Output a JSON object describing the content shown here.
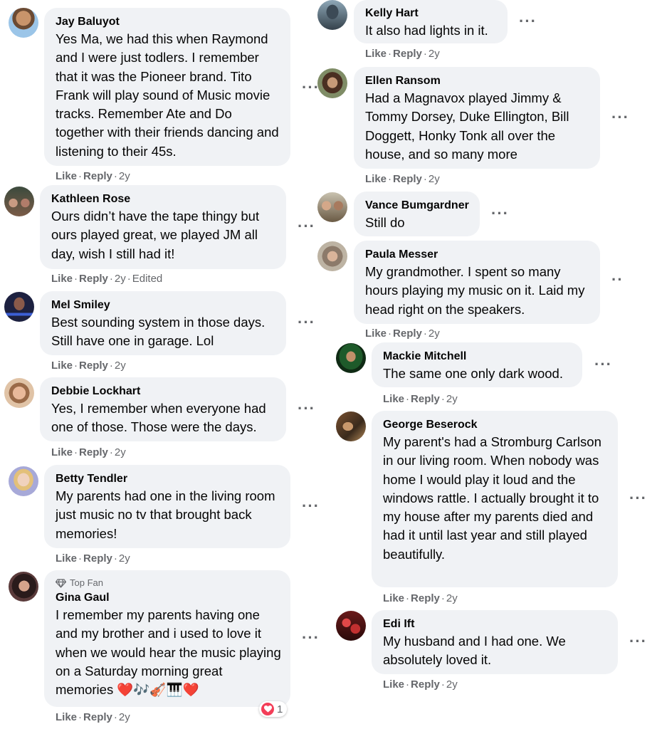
{
  "meta": {
    "like": "Like",
    "reply": "Reply",
    "dot": "·"
  },
  "comments": [
    {
      "name": "Jay Baluyot",
      "text": "Yes Ma, we had this when Raymond and I were just todlers. I remember that it was the Pioneer brand. Tito Frank will play sound of Music movie tracks. Remember Ate and Do together with their friends dancing and listening to their 45s.",
      "time": "2y"
    },
    {
      "name": "Kathleen Rose",
      "text": "Ours didn’t have the tape thingy but ours played great, we played JM all day, wish I still had it!",
      "time": "2y",
      "edited": "Edited"
    },
    {
      "name": "Mel Smiley",
      "text": "Best sounding system in those days. Still have one in garage. Lol",
      "time": "2y"
    },
    {
      "name": "Debbie Lockhart",
      "text": "Yes, I remember when everyone had one of those. Those were the days.",
      "time": "2y"
    },
    {
      "name": "Betty Tendler",
      "text": "My parents had one in the living room just music no tv that brought back memories!",
      "time": "2y"
    },
    {
      "badge": "Top Fan",
      "name": "Gina Gaul",
      "text": "I remember my parents having one and my brother and i used to love it when we would hear the music playing on a Saturday morning great memories ❤️🎶🎻🎹❤️",
      "time": "2y",
      "reaction_count": "1"
    },
    {
      "name": "Kelly Hart",
      "text": "It also had lights in it.",
      "time": "2y"
    },
    {
      "name": "Ellen Ransom",
      "text": "Had a Magnavox played Jimmy & Tommy Dorsey, Duke Ellington, Bill Doggett, Honky Tonk all over the house, and so many more",
      "time": "2y"
    },
    {
      "name": "Vance Bumgardner",
      "text": "Still do",
      "time": ""
    },
    {
      "name": "Paula Messer",
      "text": "My grandmother. I spent so many hours playing my music on it. Laid my head right on the speakers.",
      "time": "2y"
    },
    {
      "name": "Mackie Mitchell",
      "text": "The same one only dark wood.",
      "time": "2y"
    },
    {
      "name": "George Beserock",
      "text": "My parent's had a Stromburg Carlson in our living room. When nobody was home I would play it loud and the windows rattle. I actually brought it to my house after my parents died and had it until last year and still played beautifully.",
      "time": "2y"
    },
    {
      "name": "Edi Ift",
      "text": "My husband and I had one. We absolutely loved it.",
      "time": "2y"
    }
  ]
}
